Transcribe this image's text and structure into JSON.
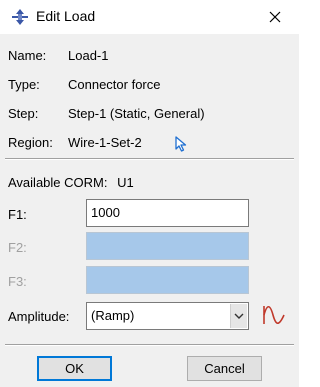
{
  "window": {
    "title": "Edit Load",
    "icon": "load-arrows-icon",
    "close_icon": "close-icon"
  },
  "info": {
    "name_label": "Name:",
    "name_value": "Load-1",
    "type_label": "Type:",
    "type_value": "Connector force",
    "step_label": "Step:",
    "step_value": "Step-1 (Static, General)",
    "region_label": "Region:",
    "region_value": "Wire-1-Set-2",
    "region_icon": "select-cursor-icon"
  },
  "corm": {
    "label": "Available CORM:",
    "value": "U1"
  },
  "fields": {
    "f1_label": "F1:",
    "f1_value": "1000",
    "f2_label": "F2:",
    "f2_value": "",
    "f3_label": "F3:",
    "f3_value": ""
  },
  "amplitude": {
    "label": "Amplitude:",
    "selected": "(Ramp)",
    "icon": "amplitude-wave-icon"
  },
  "buttons": {
    "ok": "OK",
    "cancel": "Cancel"
  },
  "colors": {
    "dialog_bg": "#f0f0f0",
    "disabled_field": "#a6c8ea",
    "accent_blue": "#0078d7",
    "amplitude_icon": "#c0392b"
  }
}
